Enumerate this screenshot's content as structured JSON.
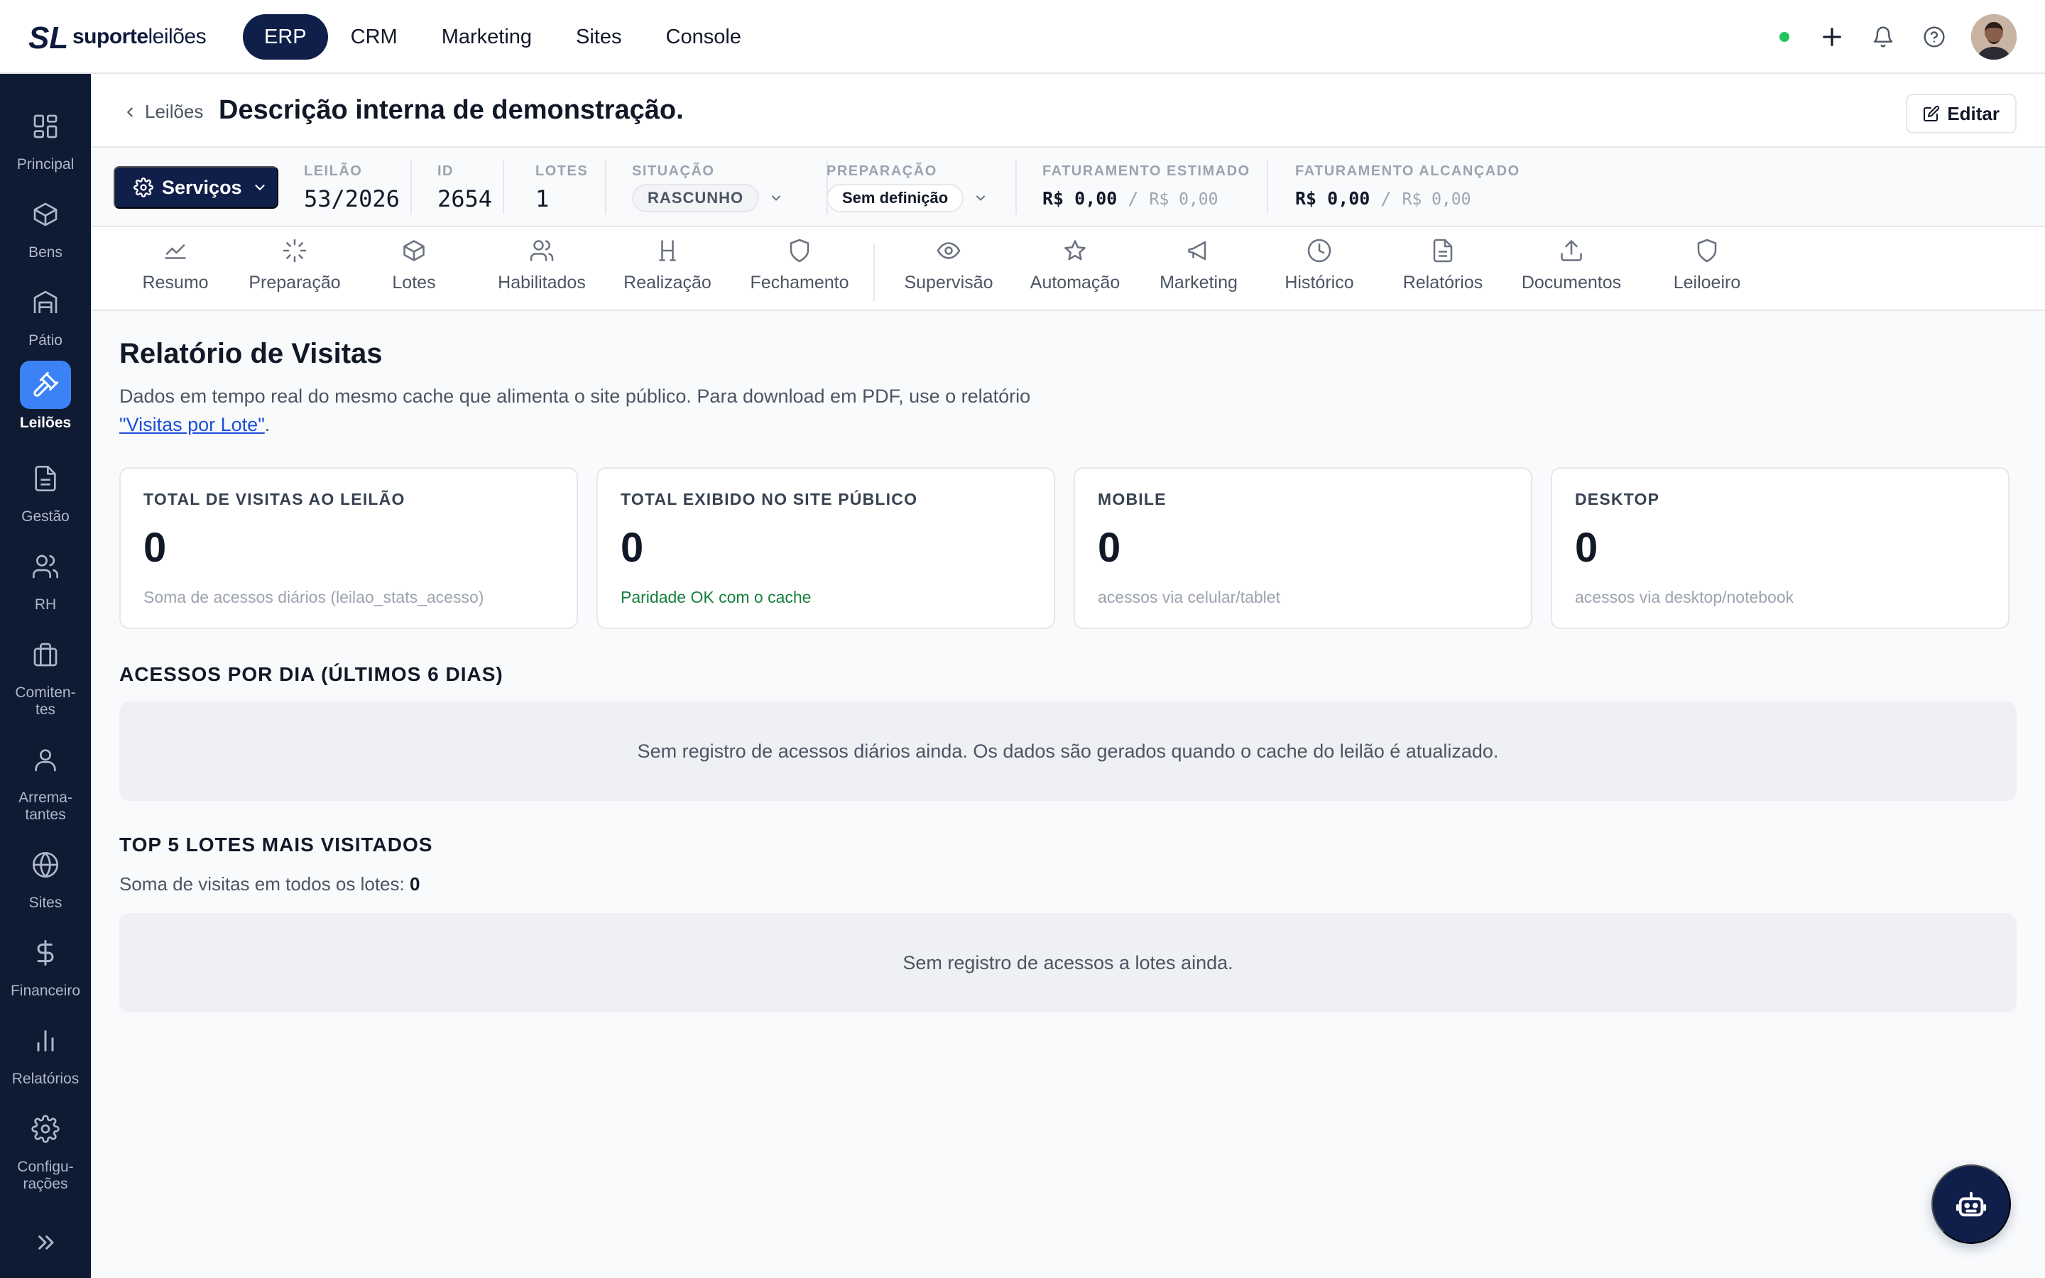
{
  "brand": {
    "logo_mark": "SL",
    "name_bold": "suporte",
    "name_light": "leilões"
  },
  "topnav": [
    {
      "label": "ERP",
      "active": true
    },
    {
      "label": "CRM"
    },
    {
      "label": "Marketing"
    },
    {
      "label": "Sites"
    },
    {
      "label": "Console"
    }
  ],
  "topbar_icons": [
    "status-online-dot",
    "plus-icon",
    "bell-icon",
    "help-icon",
    "user-avatar"
  ],
  "sidebar": {
    "items": [
      {
        "label": "Principal",
        "icon": "grid-icon"
      },
      {
        "label": "Bens",
        "icon": "box-icon"
      },
      {
        "label": "Pátio",
        "icon": "warehouse-icon"
      },
      {
        "label": "Leilões",
        "icon": "gavel-icon",
        "active": true
      },
      {
        "label": "Gestão",
        "icon": "document-icon"
      },
      {
        "label": "RH",
        "icon": "users-icon"
      },
      {
        "label": "Comiten-\ntes",
        "icon": "briefcase-icon"
      },
      {
        "label": "Arrema-\ntantes",
        "icon": "user-icon"
      },
      {
        "label": "Sites",
        "icon": "globe-icon"
      },
      {
        "label": "Financeiro",
        "icon": "dollar-icon"
      },
      {
        "label": "Relatórios",
        "icon": "bar-chart-icon"
      },
      {
        "label": "Configu-\nrações",
        "icon": "settings-icon"
      }
    ]
  },
  "header": {
    "back_label": "Leilões",
    "title": "Descrição interna de demonstração.",
    "edit_label": "Editar"
  },
  "info": {
    "services_label": "Serviços",
    "leilao": {
      "label": "LEILÃO",
      "value": "53/2026"
    },
    "id": {
      "label": "ID",
      "value": "2654"
    },
    "lotes": {
      "label": "LOTES",
      "value": "1"
    },
    "situacao": {
      "label": "SITUAÇÃO",
      "value": "RASCUNHO"
    },
    "preparacao": {
      "label": "PREPARAÇÃO",
      "value": "Sem definição"
    },
    "fat_estimado": {
      "label": "FATURAMENTO ESTIMADO",
      "value": "R$ 0,00",
      "sep": "/",
      "prev": "R$ 0,00"
    },
    "fat_alcancado": {
      "label": "FATURAMENTO ALCANÇADO",
      "value": "R$ 0,00",
      "sep": "/",
      "prev": "R$ 0,00"
    }
  },
  "tabs": [
    {
      "label": "Resumo",
      "icon": "trend-icon"
    },
    {
      "label": "Preparação",
      "icon": "loader-icon"
    },
    {
      "label": "Lotes",
      "icon": "box-icon"
    },
    {
      "label": "Habilitados",
      "icon": "users-icon"
    },
    {
      "label": "Realização",
      "icon": "gavel-icon"
    },
    {
      "label": "Fechamento",
      "icon": "shield-icon"
    },
    {
      "label": "Supervisão",
      "icon": "eye-icon"
    },
    {
      "label": "Automação",
      "icon": "sparkle-icon"
    },
    {
      "label": "Marketing",
      "icon": "megaphone-icon"
    },
    {
      "label": "Histórico",
      "icon": "clock-icon"
    },
    {
      "label": "Relatórios",
      "icon": "file-icon"
    },
    {
      "label": "Documentos",
      "icon": "upload-icon"
    },
    {
      "label": "Leiloeiro",
      "icon": "shield-icon"
    }
  ],
  "report": {
    "title": "Relatório de Visitas",
    "desc_text": "Dados em tempo real do mesmo cache que alimenta o site público. Para download em PDF, use o relatório",
    "desc_link": "\"Visitas por Lote\"",
    "desc_end": ".",
    "cards": [
      {
        "label": "TOTAL DE VISITAS AO LEILÃO",
        "value": "0",
        "note": "Soma de acessos diários (leilao_stats_acesso)",
        "note_ok": false
      },
      {
        "label": "TOTAL EXIBIDO NO SITE PÚBLICO",
        "value": "0",
        "note": "Paridade OK com o cache",
        "note_ok": true
      },
      {
        "label": "MOBILE",
        "value": "0",
        "note": "acessos via celular/tablet",
        "note_ok": false
      },
      {
        "label": "DESKTOP",
        "value": "0",
        "note": "acessos via desktop/notebook",
        "note_ok": false
      }
    ],
    "daily_title": "ACESSOS POR DIA (ÚLTIMOS 6 DIAS)",
    "daily_empty": "Sem registro de acessos diários ainda. Os dados são gerados quando o cache do leilão é atualizado.",
    "top_title": "TOP 5 LOTES MAIS VISITADOS",
    "top_sum_label": "Soma de visitas em todos os lotes:",
    "top_sum_value": "0",
    "top_empty": "Sem registro de acessos a lotes ainda."
  },
  "colors": {
    "nav_active": "#0f1f4a",
    "sidebar_bg": "#0f1a33",
    "sidebar_active": "#3b82f6",
    "link": "#1d4ed8",
    "ok_green": "#15803d",
    "status_dot": "#22c55e"
  }
}
